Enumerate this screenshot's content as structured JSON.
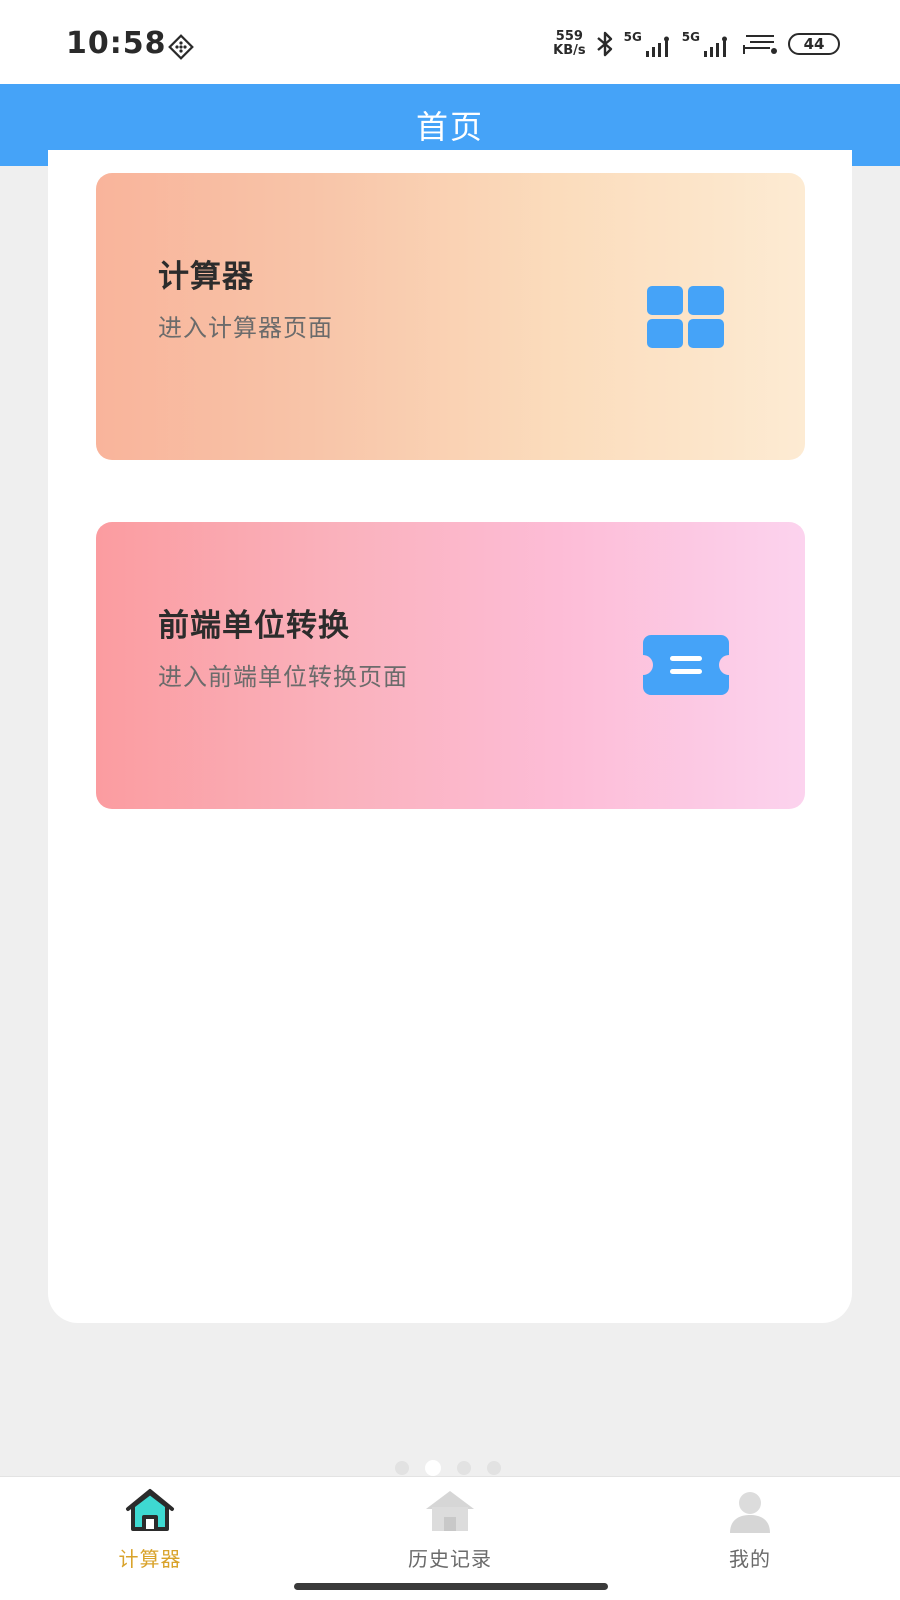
{
  "status_bar": {
    "time": "10:58",
    "net_speed_value": "559",
    "net_speed_unit": "KB/s",
    "sim1_label": "5G",
    "sim2_label": "5G",
    "battery": "44",
    "icons": [
      "diamond-grid-icon",
      "bluetooth-icon",
      "signal-icon",
      "wifi-icon",
      "battery-icon"
    ]
  },
  "header": {
    "title": "首页"
  },
  "cards": [
    {
      "title": "计算器",
      "subtitle": "进入计算器页面",
      "icon": "grid-icon"
    },
    {
      "title": "前端单位转换",
      "subtitle": "进入前端单位转换页面",
      "icon": "ticket-icon"
    }
  ],
  "tabbar": {
    "items": [
      {
        "label": "计算器",
        "icon": "home-icon",
        "active": true
      },
      {
        "label": "历史记录",
        "icon": "house-icon",
        "active": false
      },
      {
        "label": "我的",
        "icon": "user-icon",
        "active": false
      }
    ],
    "active_color": "#d9a32b",
    "inactive_color": "#6a6a6a"
  },
  "colors": {
    "accent": "#45a3f8",
    "background": "#efefef"
  }
}
